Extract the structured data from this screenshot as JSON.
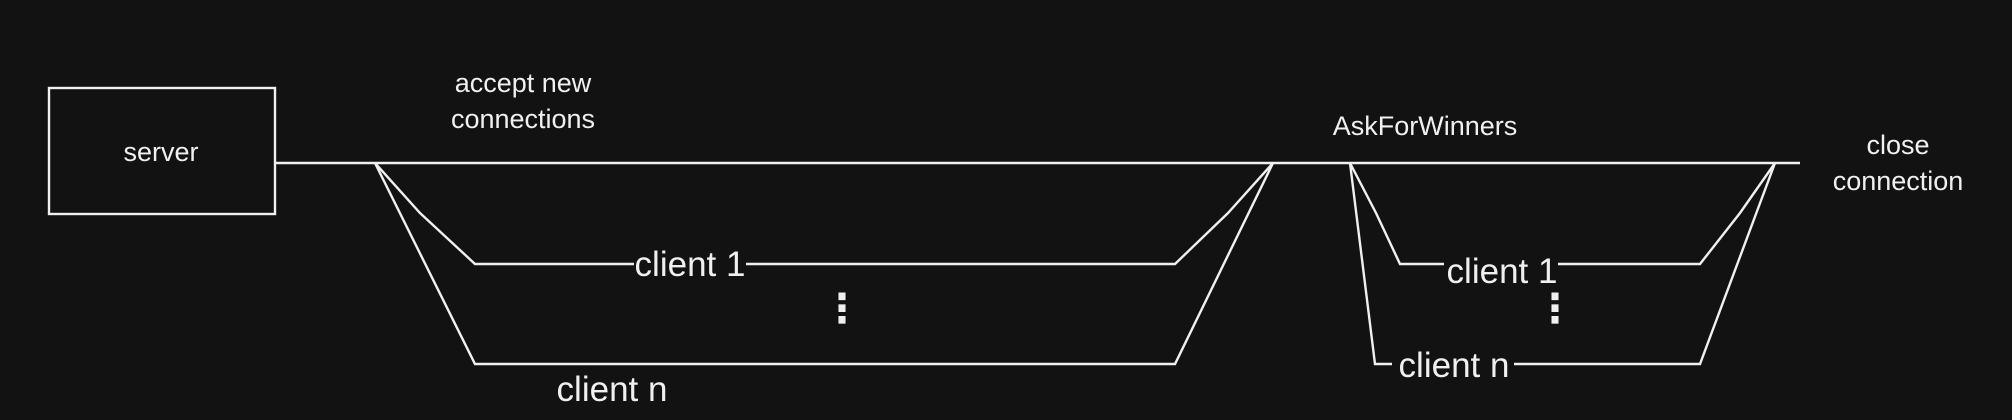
{
  "server": {
    "label": "server"
  },
  "accept_phase": {
    "label_line1": "accept new",
    "label_line2": "connections",
    "client_first": "client 1",
    "ellipsis": "⋮",
    "client_last": "client n"
  },
  "winners_phase": {
    "label": "AskForWinners",
    "client_first": "client 1",
    "ellipsis": "⋮",
    "client_last": "client n"
  },
  "close_phase": {
    "label_line1": "close",
    "label_line2": "connection"
  },
  "colors": {
    "background": "#121212",
    "foreground": "#f0f0f0"
  }
}
